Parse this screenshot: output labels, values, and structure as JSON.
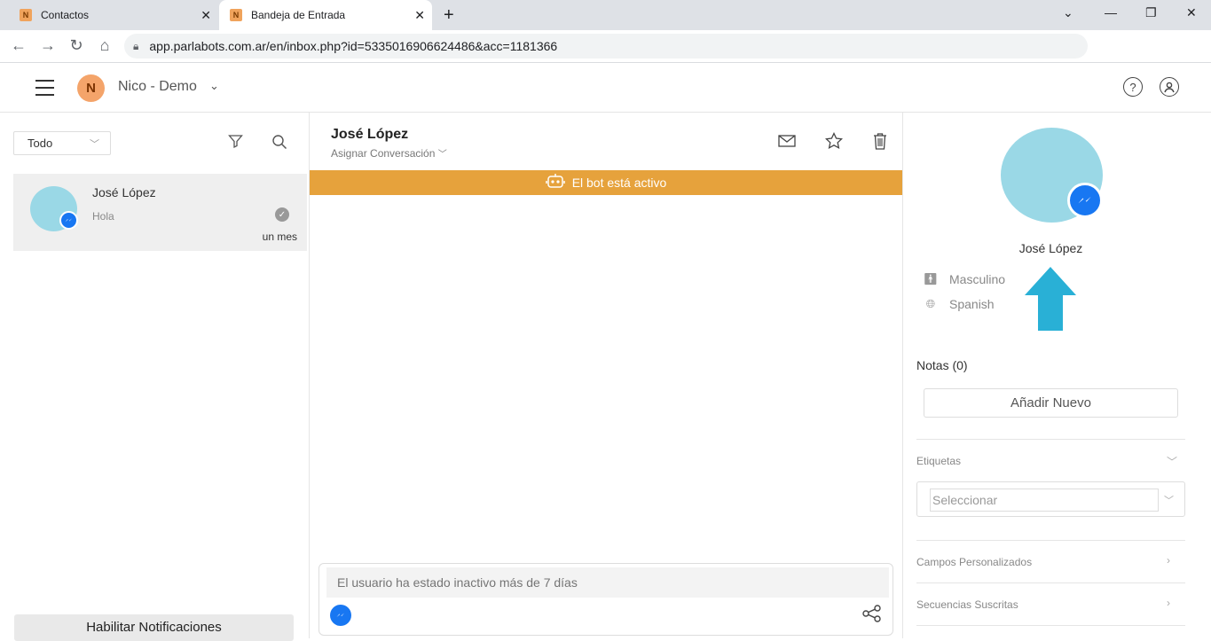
{
  "browser": {
    "tabs": [
      {
        "favicon": "N",
        "title": "Contactos"
      },
      {
        "favicon": "N",
        "title": "Bandeja de Entrada"
      }
    ],
    "url": "app.parlabots.com.ar/en/inbox.php?id=5335016906624486&acc=1181366"
  },
  "header": {
    "logo_letter": "N",
    "account_name": "Nico - Demo"
  },
  "sidebar": {
    "filter_value": "Todo",
    "conversations": [
      {
        "name": "José López",
        "snippet": "Hola",
        "time": "un mes"
      }
    ],
    "notif_button": "Habilitar Notificaciones"
  },
  "chat": {
    "contact_name": "José López",
    "assign_label": "Asignar Conversación",
    "bot_banner": "El bot está activo",
    "composer_placeholder": "El usuario ha estado inactivo más de 7 días"
  },
  "profile": {
    "name": "José López",
    "gender": "Masculino",
    "language": "Spanish",
    "notes_heading": "Notas (0)",
    "add_note_button": "Añadir Nuevo",
    "tags_heading": "Etiquetas",
    "tags_placeholder": "Seleccionar",
    "custom_fields_heading": "Campos Personalizados",
    "sequences_heading": "Secuencias Suscritas"
  },
  "colors": {
    "bot_banner": "#e6a23c",
    "avatar": "#9ad8e6",
    "messenger": "#1877f2",
    "arrow": "#29b0d6",
    "logo": "#f4a46a"
  },
  "icons": [
    "menu-icon",
    "help-icon",
    "user-icon",
    "filter-icon",
    "search-icon",
    "mail-icon",
    "star-icon",
    "trash-icon",
    "robot-icon",
    "messenger-icon",
    "share-icon",
    "person-icon",
    "globe-icon",
    "check-icon",
    "chevron-down-icon",
    "chevron-right-icon"
  ]
}
